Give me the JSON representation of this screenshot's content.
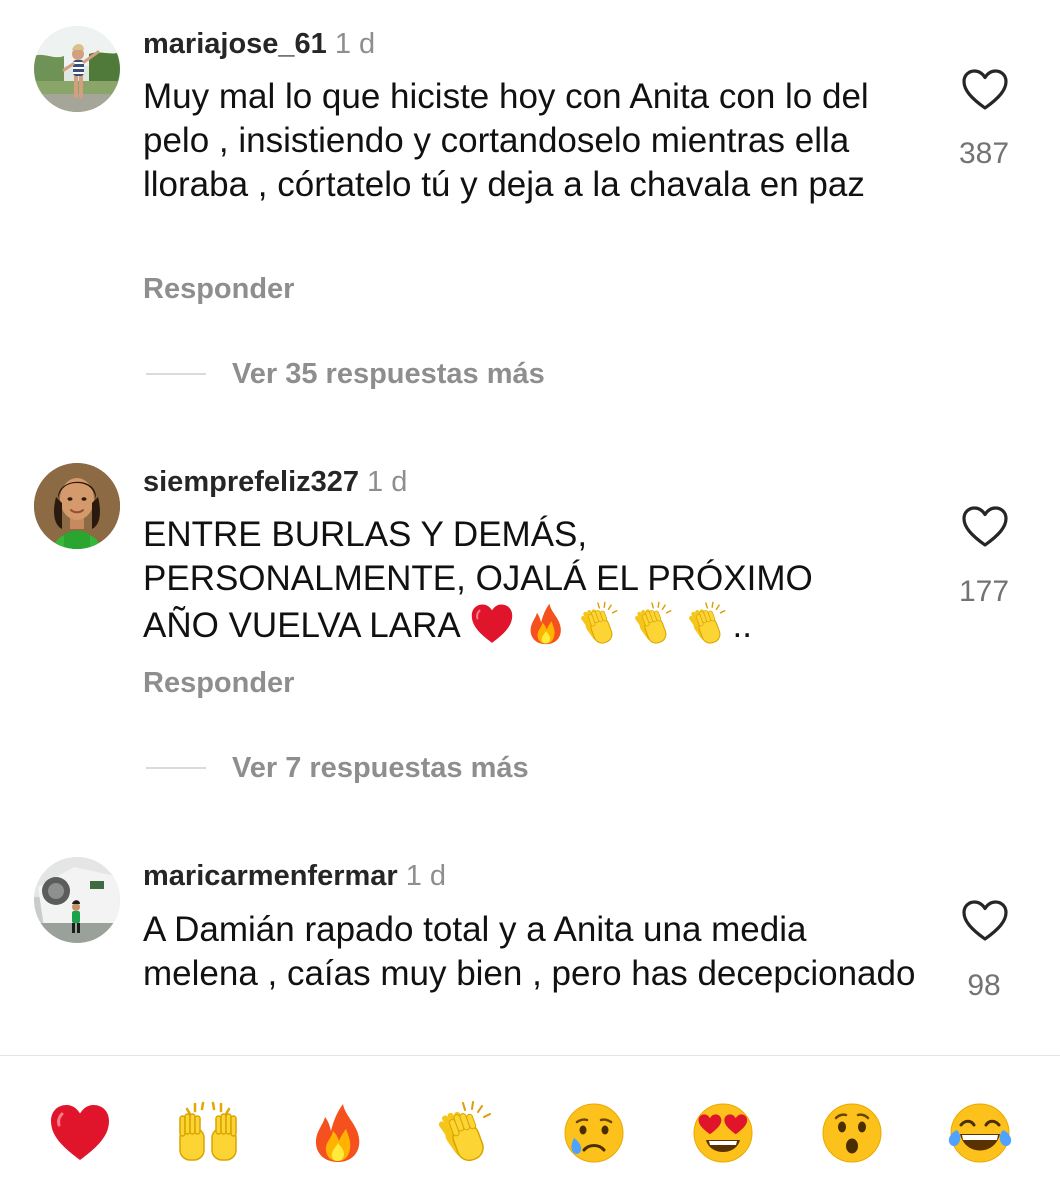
{
  "comments": [
    {
      "username": "mariajose_61",
      "time": "1 d",
      "text": "Muy mal lo que hiciste hoy con Anita con lo del pelo , insistiendo y cortandoselo mientras ella lloraba , córtatelo tú y deja a la chavala en paz",
      "likes": "387",
      "reply_label": "Responder",
      "view_replies": "Ver 35 respuestas más"
    },
    {
      "username": "siemprefeliz327",
      "time": "1 d",
      "text_line1": "ENTRE BURLAS Y DEMÁS,",
      "text_line2": "PERSONALMENTE, OJALÁ EL PRÓXIMO",
      "text_line3": "AÑO VUELVA LARA",
      "text_trailing": "..",
      "text_emojis": [
        "red-heart",
        "fire",
        "clapping-hands",
        "clapping-hands",
        "clapping-hands"
      ],
      "likes": "177",
      "reply_label": "Responder",
      "view_replies": "Ver 7 respuestas más"
    },
    {
      "username": "maricarmenfermar",
      "time": "1 d",
      "text": "A Damián rapado total y a Anita una media melena , caías muy bien , pero has decepcionado",
      "likes": "98"
    }
  ],
  "reaction_bar": [
    "red-heart",
    "raising-hands",
    "fire",
    "clapping-hands",
    "crying-face",
    "heart-eyes-face",
    "surprised-face",
    "tears-of-joy-face"
  ],
  "colors": {
    "secondary_text": "#8e8e8e",
    "primary_text": "#111111",
    "divider": "#dbdbdb"
  }
}
